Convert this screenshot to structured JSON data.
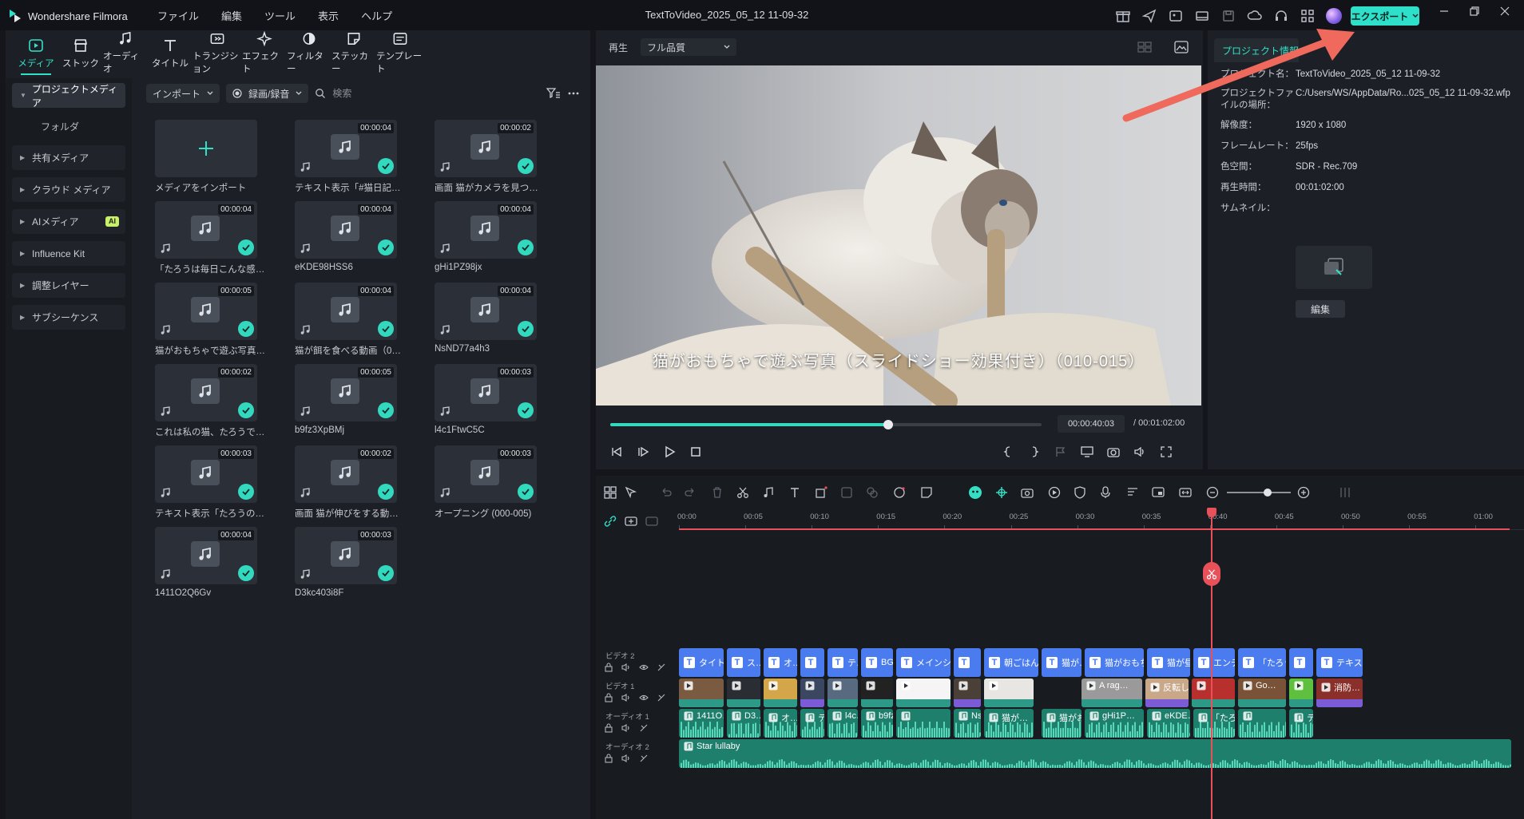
{
  "app": {
    "name": "Wondershare Filmora",
    "document_title": "TextToVideo_2025_05_12 11-09-32"
  },
  "menu": [
    "ファイル",
    "編集",
    "ツール",
    "表示",
    "ヘルプ"
  ],
  "header": {
    "export_label": "エクスポート"
  },
  "media_tabs": [
    "メディア",
    "ストック",
    "オーディオ",
    "タイトル",
    "トランジション",
    "エフェクト",
    "フィルター",
    "ステッカー",
    "テンプレート"
  ],
  "side_nav": {
    "project_media": "プロジェクトメディア",
    "folder": "フォルダ",
    "items": [
      "共有メディア",
      "クラウド メディア",
      "AIメディア",
      "Influence Kit",
      "調整レイヤー",
      "サブシーケンス"
    ],
    "ai_badge": "AI"
  },
  "filters": {
    "import_label": "インポート",
    "record_label": "録画/録音",
    "search_placeholder": "検索"
  },
  "media": [
    {
      "label": "メディアをインポート",
      "duration": ""
    },
    {
      "label": "テキスト表示「#猫日記…",
      "duration": "00:00:04"
    },
    {
      "label": "画面 猫がカメラを見つめ…",
      "duration": "00:00:02"
    },
    {
      "label": "「たろうは毎日こんな感じ…",
      "duration": "00:00:04"
    },
    {
      "label": "eKDE98HSS6",
      "duration": "00:00:04"
    },
    {
      "label": "gHi1PZ98jx",
      "duration": "00:00:04"
    },
    {
      "label": "猫がおもちゃで遊ぶ写真…",
      "duration": "00:00:05"
    },
    {
      "label": "猫が餌を食べる動画（0…",
      "duration": "00:00:04"
    },
    {
      "label": "NsND77a4h3",
      "duration": "00:00:04"
    },
    {
      "label": "これは私の猫、たろうです。",
      "duration": "00:00:02"
    },
    {
      "label": "b9fz3XpBMj",
      "duration": "00:00:05"
    },
    {
      "label": "l4c1FtwC5C",
      "duration": "00:00:03"
    },
    {
      "label": "テキスト表示「たろうの一…",
      "duration": "00:00:03"
    },
    {
      "label": "画面 猫が伸びをする動…",
      "duration": "00:00:02"
    },
    {
      "label": "オープニング (000-005)",
      "duration": "00:00:03"
    },
    {
      "label": "1411O2Q6Gv",
      "duration": "00:00:04"
    },
    {
      "label": "D3kc403i8F",
      "duration": "00:00:03"
    }
  ],
  "player": {
    "play_label": "再生",
    "quality": "フル品質",
    "subtitle": "猫がおもちゃで遊ぶ写真（スライドショー効果付き）（010-015）",
    "current_time": "00:00:40:03",
    "total_time": "/  00:01:02:00",
    "progress": 0.645
  },
  "project_info": {
    "tab_label": "プロジェクト情報",
    "rows": [
      {
        "key": "プロジェクト名：",
        "value": "TextToVideo_2025_05_12 11-09-32"
      },
      {
        "key": "プロジェクトファイルの場所：",
        "value": "C:/Users/WS/AppData/Ro...025_05_12 11-09-32.wfp"
      },
      {
        "key": "解像度：",
        "value": "1920 x 1080"
      },
      {
        "key": "フレームレート：",
        "value": "25fps"
      },
      {
        "key": "色空間：",
        "value": "SDR - Rec.709"
      },
      {
        "key": "再生時間：",
        "value": "00:01:02:00"
      },
      {
        "key": "サムネイル：",
        "value": ""
      }
    ],
    "edit_label": "編集"
  },
  "timeline": {
    "ruler": [
      "00:00",
      "00:05",
      "00:10",
      "00:15",
      "00:20",
      "00:25",
      "00:30",
      "00:35",
      "00:40",
      "00:45",
      "00:50",
      "00:55",
      "01:00"
    ],
    "playhead_seconds": 40.1,
    "tracks": {
      "video2": "ビデオ 2",
      "video1": "ビデオ 1",
      "audio1": "オーディオ 1",
      "audio2": "オーディオ 2"
    },
    "title_clips": [
      "タイト…",
      "ス…",
      "オ…",
      "",
      "テ…",
      "BG…",
      "メインシー…",
      "",
      "朝ごはん…",
      "猫が…",
      "猫がおもち…",
      "猫が昼…",
      "エンデ…",
      "「たろう…",
      "",
      "テキス…"
    ],
    "video_clips": [
      "",
      "",
      "",
      "",
      "",
      "",
      "",
      "",
      "",
      "A rag…",
      "反転し…",
      "",
      "Go…",
      "",
      "消防…"
    ],
    "audio1_clips": [
      "1411O…",
      "D3…",
      "オ…",
      "テ…",
      "l4c…",
      "b9fz3XpB…",
      "",
      "NsND7…",
      "猫が…",
      "猫がおもち…",
      "gHi1P…",
      "eKDE…",
      "「たろう…",
      "",
      "テキス…"
    ],
    "audio2_clip": "Star lullaby"
  },
  "colors": {
    "accent": "#33e0c6",
    "playhead": "#e8515a",
    "title_clip": "#4a7cf0",
    "video_clip": "#2c9a86",
    "audio_clip": "#1f7f6d"
  }
}
